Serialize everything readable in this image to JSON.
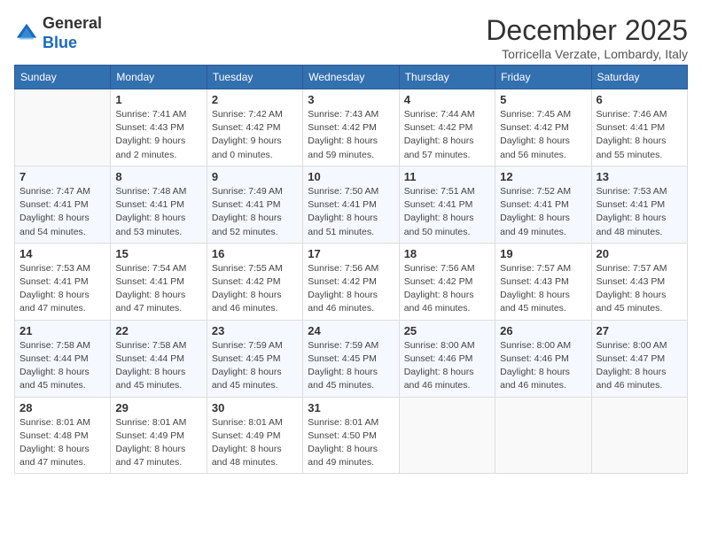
{
  "header": {
    "logo_general": "General",
    "logo_blue": "Blue",
    "title": "December 2025",
    "subtitle": "Torricella Verzate, Lombardy, Italy"
  },
  "days_of_week": [
    "Sunday",
    "Monday",
    "Tuesday",
    "Wednesday",
    "Thursday",
    "Friday",
    "Saturday"
  ],
  "weeks": [
    [
      {
        "day": "",
        "sunrise": "",
        "sunset": "",
        "daylight": ""
      },
      {
        "day": "1",
        "sunrise": "Sunrise: 7:41 AM",
        "sunset": "Sunset: 4:43 PM",
        "daylight": "Daylight: 9 hours and 2 minutes."
      },
      {
        "day": "2",
        "sunrise": "Sunrise: 7:42 AM",
        "sunset": "Sunset: 4:42 PM",
        "daylight": "Daylight: 9 hours and 0 minutes."
      },
      {
        "day": "3",
        "sunrise": "Sunrise: 7:43 AM",
        "sunset": "Sunset: 4:42 PM",
        "daylight": "Daylight: 8 hours and 59 minutes."
      },
      {
        "day": "4",
        "sunrise": "Sunrise: 7:44 AM",
        "sunset": "Sunset: 4:42 PM",
        "daylight": "Daylight: 8 hours and 57 minutes."
      },
      {
        "day": "5",
        "sunrise": "Sunrise: 7:45 AM",
        "sunset": "Sunset: 4:42 PM",
        "daylight": "Daylight: 8 hours and 56 minutes."
      },
      {
        "day": "6",
        "sunrise": "Sunrise: 7:46 AM",
        "sunset": "Sunset: 4:41 PM",
        "daylight": "Daylight: 8 hours and 55 minutes."
      }
    ],
    [
      {
        "day": "7",
        "sunrise": "Sunrise: 7:47 AM",
        "sunset": "Sunset: 4:41 PM",
        "daylight": "Daylight: 8 hours and 54 minutes."
      },
      {
        "day": "8",
        "sunrise": "Sunrise: 7:48 AM",
        "sunset": "Sunset: 4:41 PM",
        "daylight": "Daylight: 8 hours and 53 minutes."
      },
      {
        "day": "9",
        "sunrise": "Sunrise: 7:49 AM",
        "sunset": "Sunset: 4:41 PM",
        "daylight": "Daylight: 8 hours and 52 minutes."
      },
      {
        "day": "10",
        "sunrise": "Sunrise: 7:50 AM",
        "sunset": "Sunset: 4:41 PM",
        "daylight": "Daylight: 8 hours and 51 minutes."
      },
      {
        "day": "11",
        "sunrise": "Sunrise: 7:51 AM",
        "sunset": "Sunset: 4:41 PM",
        "daylight": "Daylight: 8 hours and 50 minutes."
      },
      {
        "day": "12",
        "sunrise": "Sunrise: 7:52 AM",
        "sunset": "Sunset: 4:41 PM",
        "daylight": "Daylight: 8 hours and 49 minutes."
      },
      {
        "day": "13",
        "sunrise": "Sunrise: 7:53 AM",
        "sunset": "Sunset: 4:41 PM",
        "daylight": "Daylight: 8 hours and 48 minutes."
      }
    ],
    [
      {
        "day": "14",
        "sunrise": "Sunrise: 7:53 AM",
        "sunset": "Sunset: 4:41 PM",
        "daylight": "Daylight: 8 hours and 47 minutes."
      },
      {
        "day": "15",
        "sunrise": "Sunrise: 7:54 AM",
        "sunset": "Sunset: 4:41 PM",
        "daylight": "Daylight: 8 hours and 47 minutes."
      },
      {
        "day": "16",
        "sunrise": "Sunrise: 7:55 AM",
        "sunset": "Sunset: 4:42 PM",
        "daylight": "Daylight: 8 hours and 46 minutes."
      },
      {
        "day": "17",
        "sunrise": "Sunrise: 7:56 AM",
        "sunset": "Sunset: 4:42 PM",
        "daylight": "Daylight: 8 hours and 46 minutes."
      },
      {
        "day": "18",
        "sunrise": "Sunrise: 7:56 AM",
        "sunset": "Sunset: 4:42 PM",
        "daylight": "Daylight: 8 hours and 46 minutes."
      },
      {
        "day": "19",
        "sunrise": "Sunrise: 7:57 AM",
        "sunset": "Sunset: 4:43 PM",
        "daylight": "Daylight: 8 hours and 45 minutes."
      },
      {
        "day": "20",
        "sunrise": "Sunrise: 7:57 AM",
        "sunset": "Sunset: 4:43 PM",
        "daylight": "Daylight: 8 hours and 45 minutes."
      }
    ],
    [
      {
        "day": "21",
        "sunrise": "Sunrise: 7:58 AM",
        "sunset": "Sunset: 4:44 PM",
        "daylight": "Daylight: 8 hours and 45 minutes."
      },
      {
        "day": "22",
        "sunrise": "Sunrise: 7:58 AM",
        "sunset": "Sunset: 4:44 PM",
        "daylight": "Daylight: 8 hours and 45 minutes."
      },
      {
        "day": "23",
        "sunrise": "Sunrise: 7:59 AM",
        "sunset": "Sunset: 4:45 PM",
        "daylight": "Daylight: 8 hours and 45 minutes."
      },
      {
        "day": "24",
        "sunrise": "Sunrise: 7:59 AM",
        "sunset": "Sunset: 4:45 PM",
        "daylight": "Daylight: 8 hours and 45 minutes."
      },
      {
        "day": "25",
        "sunrise": "Sunrise: 8:00 AM",
        "sunset": "Sunset: 4:46 PM",
        "daylight": "Daylight: 8 hours and 46 minutes."
      },
      {
        "day": "26",
        "sunrise": "Sunrise: 8:00 AM",
        "sunset": "Sunset: 4:46 PM",
        "daylight": "Daylight: 8 hours and 46 minutes."
      },
      {
        "day": "27",
        "sunrise": "Sunrise: 8:00 AM",
        "sunset": "Sunset: 4:47 PM",
        "daylight": "Daylight: 8 hours and 46 minutes."
      }
    ],
    [
      {
        "day": "28",
        "sunrise": "Sunrise: 8:01 AM",
        "sunset": "Sunset: 4:48 PM",
        "daylight": "Daylight: 8 hours and 47 minutes."
      },
      {
        "day": "29",
        "sunrise": "Sunrise: 8:01 AM",
        "sunset": "Sunset: 4:49 PM",
        "daylight": "Daylight: 8 hours and 47 minutes."
      },
      {
        "day": "30",
        "sunrise": "Sunrise: 8:01 AM",
        "sunset": "Sunset: 4:49 PM",
        "daylight": "Daylight: 8 hours and 48 minutes."
      },
      {
        "day": "31",
        "sunrise": "Sunrise: 8:01 AM",
        "sunset": "Sunset: 4:50 PM",
        "daylight": "Daylight: 8 hours and 49 minutes."
      },
      {
        "day": "",
        "sunrise": "",
        "sunset": "",
        "daylight": ""
      },
      {
        "day": "",
        "sunrise": "",
        "sunset": "",
        "daylight": ""
      },
      {
        "day": "",
        "sunrise": "",
        "sunset": "",
        "daylight": ""
      }
    ]
  ]
}
